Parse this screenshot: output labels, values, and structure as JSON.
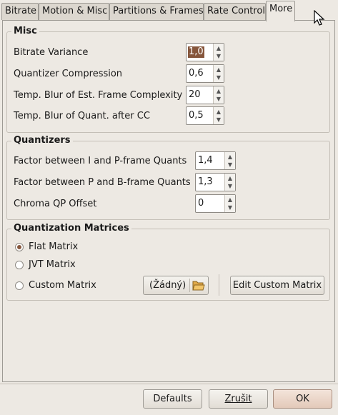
{
  "tabs": [
    {
      "label": "Bitrate"
    },
    {
      "label": "Motion & Misc"
    },
    {
      "label": "Partitions & Frames"
    },
    {
      "label": "Rate Control"
    },
    {
      "label": "More"
    }
  ],
  "misc": {
    "title": "Misc",
    "rows": [
      {
        "label": "Bitrate Variance",
        "value": "1,0"
      },
      {
        "label": "Quantizer Compression",
        "value": "0,6"
      },
      {
        "label": "Temp. Blur of Est. Frame Complexity",
        "value": "20"
      },
      {
        "label": "Temp. Blur of Quant. after CC",
        "value": "0,5"
      }
    ]
  },
  "quantizers": {
    "title": "Quantizers",
    "rows": [
      {
        "label": "Factor between I and P-frame Quants",
        "value": "1,4"
      },
      {
        "label": "Factor between P and B-frame Quants",
        "value": "1,3"
      },
      {
        "label": "Chroma QP Offset",
        "value": "0"
      }
    ]
  },
  "matrices": {
    "title": "Quantization Matrices",
    "options": [
      {
        "label": "Flat Matrix",
        "checked": true
      },
      {
        "label": "JVT Matrix",
        "checked": false
      },
      {
        "label": "Custom Matrix",
        "checked": false
      }
    ],
    "file_combo": "(Žádný)",
    "edit_button": "Edit Custom Matrix"
  },
  "footer": {
    "defaults": "Defaults",
    "cancel": "Zrušit",
    "ok": "OK"
  },
  "colors": {
    "background": "#ede9e3",
    "accent": "#86563c"
  }
}
